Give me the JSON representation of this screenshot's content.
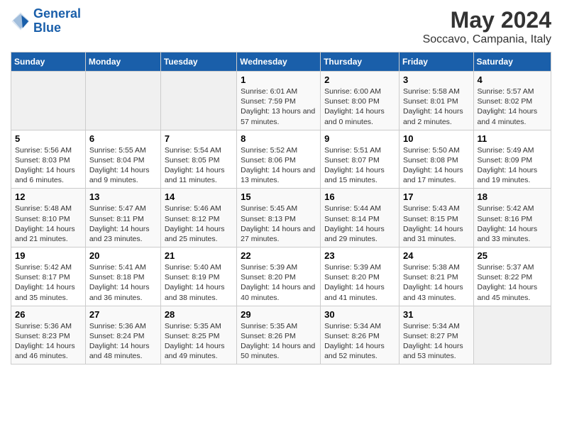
{
  "logo": {
    "line1": "General",
    "line2": "Blue"
  },
  "title": "May 2024",
  "subtitle": "Soccavo, Campania, Italy",
  "days": [
    "Sunday",
    "Monday",
    "Tuesday",
    "Wednesday",
    "Thursday",
    "Friday",
    "Saturday"
  ],
  "weeks": [
    [
      {
        "day": "",
        "info": ""
      },
      {
        "day": "",
        "info": ""
      },
      {
        "day": "",
        "info": ""
      },
      {
        "day": "1",
        "info": "Sunrise: 6:01 AM\nSunset: 7:59 PM\nDaylight: 13 hours and 57 minutes."
      },
      {
        "day": "2",
        "info": "Sunrise: 6:00 AM\nSunset: 8:00 PM\nDaylight: 14 hours and 0 minutes."
      },
      {
        "day": "3",
        "info": "Sunrise: 5:58 AM\nSunset: 8:01 PM\nDaylight: 14 hours and 2 minutes."
      },
      {
        "day": "4",
        "info": "Sunrise: 5:57 AM\nSunset: 8:02 PM\nDaylight: 14 hours and 4 minutes."
      }
    ],
    [
      {
        "day": "5",
        "info": "Sunrise: 5:56 AM\nSunset: 8:03 PM\nDaylight: 14 hours and 6 minutes."
      },
      {
        "day": "6",
        "info": "Sunrise: 5:55 AM\nSunset: 8:04 PM\nDaylight: 14 hours and 9 minutes."
      },
      {
        "day": "7",
        "info": "Sunrise: 5:54 AM\nSunset: 8:05 PM\nDaylight: 14 hours and 11 minutes."
      },
      {
        "day": "8",
        "info": "Sunrise: 5:52 AM\nSunset: 8:06 PM\nDaylight: 14 hours and 13 minutes."
      },
      {
        "day": "9",
        "info": "Sunrise: 5:51 AM\nSunset: 8:07 PM\nDaylight: 14 hours and 15 minutes."
      },
      {
        "day": "10",
        "info": "Sunrise: 5:50 AM\nSunset: 8:08 PM\nDaylight: 14 hours and 17 minutes."
      },
      {
        "day": "11",
        "info": "Sunrise: 5:49 AM\nSunset: 8:09 PM\nDaylight: 14 hours and 19 minutes."
      }
    ],
    [
      {
        "day": "12",
        "info": "Sunrise: 5:48 AM\nSunset: 8:10 PM\nDaylight: 14 hours and 21 minutes."
      },
      {
        "day": "13",
        "info": "Sunrise: 5:47 AM\nSunset: 8:11 PM\nDaylight: 14 hours and 23 minutes."
      },
      {
        "day": "14",
        "info": "Sunrise: 5:46 AM\nSunset: 8:12 PM\nDaylight: 14 hours and 25 minutes."
      },
      {
        "day": "15",
        "info": "Sunrise: 5:45 AM\nSunset: 8:13 PM\nDaylight: 14 hours and 27 minutes."
      },
      {
        "day": "16",
        "info": "Sunrise: 5:44 AM\nSunset: 8:14 PM\nDaylight: 14 hours and 29 minutes."
      },
      {
        "day": "17",
        "info": "Sunrise: 5:43 AM\nSunset: 8:15 PM\nDaylight: 14 hours and 31 minutes."
      },
      {
        "day": "18",
        "info": "Sunrise: 5:42 AM\nSunset: 8:16 PM\nDaylight: 14 hours and 33 minutes."
      }
    ],
    [
      {
        "day": "19",
        "info": "Sunrise: 5:42 AM\nSunset: 8:17 PM\nDaylight: 14 hours and 35 minutes."
      },
      {
        "day": "20",
        "info": "Sunrise: 5:41 AM\nSunset: 8:18 PM\nDaylight: 14 hours and 36 minutes."
      },
      {
        "day": "21",
        "info": "Sunrise: 5:40 AM\nSunset: 8:19 PM\nDaylight: 14 hours and 38 minutes."
      },
      {
        "day": "22",
        "info": "Sunrise: 5:39 AM\nSunset: 8:20 PM\nDaylight: 14 hours and 40 minutes."
      },
      {
        "day": "23",
        "info": "Sunrise: 5:39 AM\nSunset: 8:20 PM\nDaylight: 14 hours and 41 minutes."
      },
      {
        "day": "24",
        "info": "Sunrise: 5:38 AM\nSunset: 8:21 PM\nDaylight: 14 hours and 43 minutes."
      },
      {
        "day": "25",
        "info": "Sunrise: 5:37 AM\nSunset: 8:22 PM\nDaylight: 14 hours and 45 minutes."
      }
    ],
    [
      {
        "day": "26",
        "info": "Sunrise: 5:36 AM\nSunset: 8:23 PM\nDaylight: 14 hours and 46 minutes."
      },
      {
        "day": "27",
        "info": "Sunrise: 5:36 AM\nSunset: 8:24 PM\nDaylight: 14 hours and 48 minutes."
      },
      {
        "day": "28",
        "info": "Sunrise: 5:35 AM\nSunset: 8:25 PM\nDaylight: 14 hours and 49 minutes."
      },
      {
        "day": "29",
        "info": "Sunrise: 5:35 AM\nSunset: 8:26 PM\nDaylight: 14 hours and 50 minutes."
      },
      {
        "day": "30",
        "info": "Sunrise: 5:34 AM\nSunset: 8:26 PM\nDaylight: 14 hours and 52 minutes."
      },
      {
        "day": "31",
        "info": "Sunrise: 5:34 AM\nSunset: 8:27 PM\nDaylight: 14 hours and 53 minutes."
      },
      {
        "day": "",
        "info": ""
      }
    ]
  ]
}
